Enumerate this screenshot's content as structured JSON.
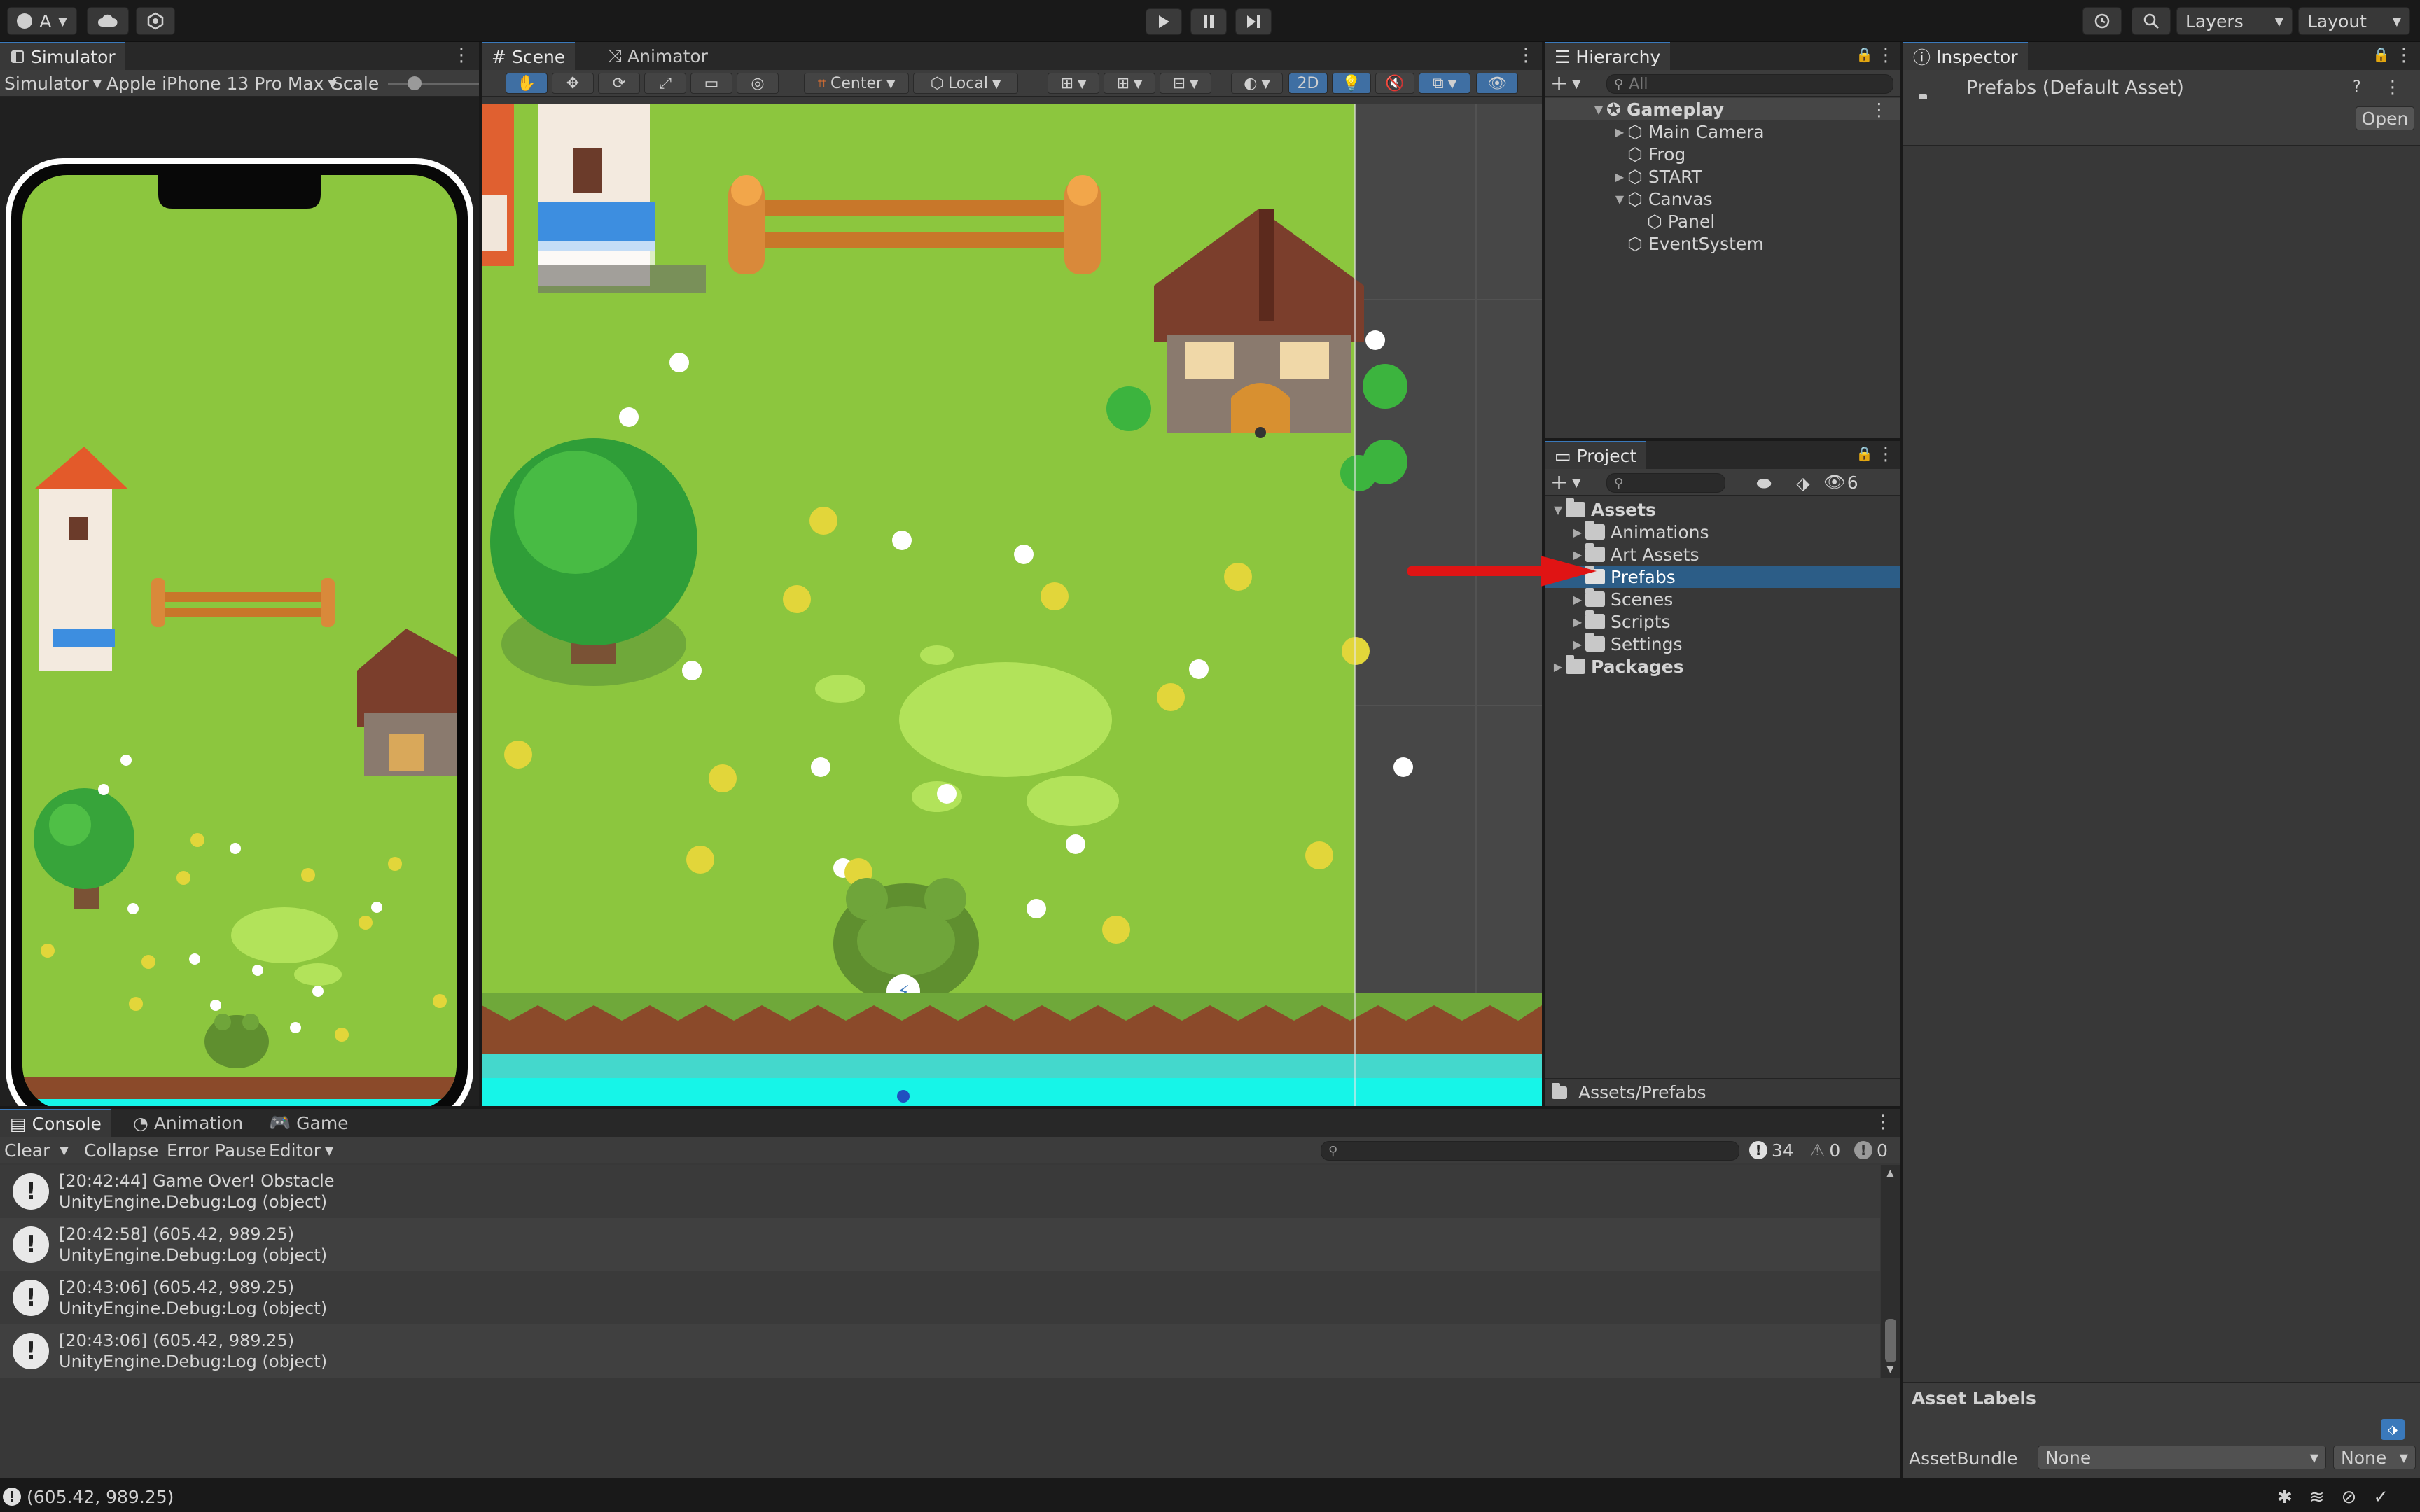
{
  "toolbar": {
    "account_label": "A",
    "layers_label": "Layers",
    "layout_label": "Layout"
  },
  "simulator": {
    "tab_label": "Simulator",
    "mode_label": "Simulator",
    "device_label": "Apple iPhone 13 Pro Max",
    "scale_label": "Scale"
  },
  "scene": {
    "tabs": [
      {
        "label": "Scene"
      },
      {
        "label": "Animator"
      }
    ],
    "pivot_label": "Center",
    "space_label": "Local",
    "mode_2d_label": "2D"
  },
  "hierarchy": {
    "tab_label": "Hierarchy",
    "search_placeholder": "All",
    "items": [
      {
        "label": "Gameplay"
      },
      {
        "label": "Main Camera"
      },
      {
        "label": "Frog"
      },
      {
        "label": "START"
      },
      {
        "label": "Canvas"
      },
      {
        "label": "Panel"
      },
      {
        "label": "EventSystem"
      }
    ]
  },
  "project": {
    "tab_label": "Project",
    "hidden_count": "6",
    "items": [
      {
        "label": "Assets"
      },
      {
        "label": "Animations"
      },
      {
        "label": "Art Assets"
      },
      {
        "label": "Prefabs"
      },
      {
        "label": "Scenes"
      },
      {
        "label": "Scripts"
      },
      {
        "label": "Settings"
      },
      {
        "label": "Packages"
      }
    ],
    "path_label": "Assets/Prefabs"
  },
  "inspector": {
    "tab_label": "Inspector",
    "asset_title": "Prefabs (Default Asset)",
    "open_label": "Open",
    "asset_labels_title": "Asset Labels",
    "asset_bundle_label": "AssetBundle",
    "bundle_value": "None",
    "variant_value": "None"
  },
  "console": {
    "tabs": [
      {
        "label": "Console"
      },
      {
        "label": "Animation"
      },
      {
        "label": "Game"
      }
    ],
    "clear_label": "Clear",
    "collapse_label": "Collapse",
    "error_pause_label": "Error Pause",
    "editor_label": "Editor",
    "log_count": "34",
    "warn_count": "0",
    "error_count": "0",
    "logs": [
      {
        "line1": "[20:42:44] Game Over! Obstacle",
        "line2": "UnityEngine.Debug:Log (object)"
      },
      {
        "line1": "[20:42:58] (605.42, 989.25)",
        "line2": "UnityEngine.Debug:Log (object)"
      },
      {
        "line1": "[20:43:06] (605.42, 989.25)",
        "line2": "UnityEngine.Debug:Log (object)"
      },
      {
        "line1": "[20:43:06] (605.42, 989.25)",
        "line2": "UnityEngine.Debug:Log (object)"
      }
    ]
  },
  "status_bar": {
    "message": "(605.42, 989.25)"
  },
  "colors": {
    "grass": "#8cc63e",
    "water": "#16f5e8",
    "selection": "#2c5d87",
    "arrow": "#e01414",
    "accent": "#3a79bb"
  }
}
